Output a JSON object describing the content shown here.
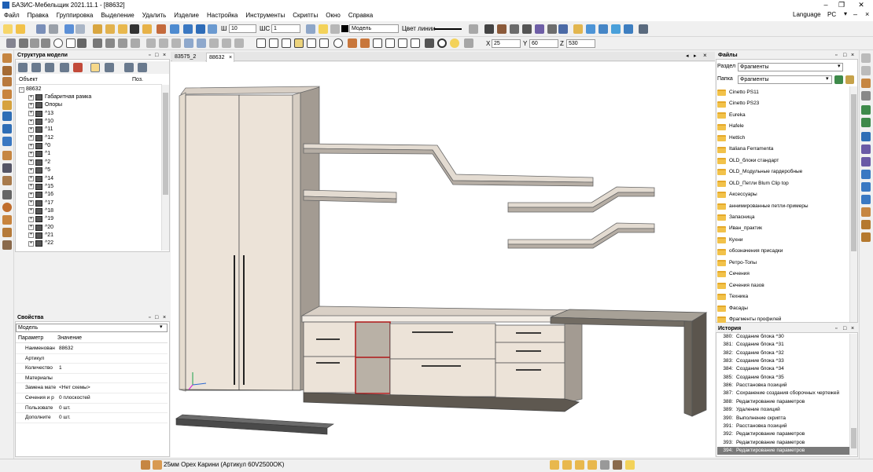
{
  "window": {
    "title": "БАЗИС-Мебельщик 2021.11.1 - [88632]"
  },
  "menu": [
    "Файл",
    "Правка",
    "Группировка",
    "Выделение",
    "Удалить",
    "Изделие",
    "Настройка",
    "Инструменты",
    "Скрипты",
    "Окно",
    "Справка"
  ],
  "menu_right": {
    "language": "Language",
    "locale": "PC"
  },
  "toolbar": {
    "line_width": "10",
    "sc_label": "ШС",
    "sc_value": "1",
    "w_label": "Ш",
    "layer": "Модель",
    "line_color_label": "Цвет линии",
    "x_label": "X",
    "x_value": "25",
    "y_label": "Y",
    "y_value": "60",
    "z_label": "Z",
    "z_value": "530"
  },
  "tabs": [
    {
      "label": "83575_2",
      "active": false
    },
    {
      "label": "88632",
      "active": true
    }
  ],
  "model_tree": {
    "title": "Структура модели",
    "col_object": "Объект",
    "col_pos": "Поз.",
    "root": "88632",
    "items": [
      "Габаритная рамка",
      "Опоры",
      "^13",
      "^10",
      "^11",
      "^12",
      "^0",
      "^1",
      "^2",
      "^5",
      "^14",
      "^15",
      "^16",
      "^17",
      "^18",
      "^19",
      "^20",
      "^21",
      "^22"
    ]
  },
  "properties": {
    "title": "Свойства",
    "selector": "Модель",
    "col_param": "Параметр",
    "col_value": "Значение",
    "rows": [
      {
        "param": "Наименован",
        "value": "88632"
      },
      {
        "param": "Артикул",
        "value": ""
      },
      {
        "param": "Количество",
        "value": "1"
      },
      {
        "param": "Материалы",
        "value": ""
      },
      {
        "param": "Замена мате",
        "value": "<Нет схемы>"
      },
      {
        "param": "Сечения и р",
        "value": "0 плоскостей"
      },
      {
        "param": "Пользовате",
        "value": "0 шт."
      },
      {
        "param": "Дополните",
        "value": "0 шт."
      }
    ]
  },
  "files": {
    "title": "Файлы",
    "section_label": "Раздел",
    "section_value": "Фрагменты",
    "folder_label": "Папка",
    "folder_value": "Фрагменты",
    "folders": [
      "Cinetto PS11",
      "Cinetto PS23",
      "Eureka",
      "Hafele",
      "Hettich",
      "Italiana Ferramenta",
      "OLD_блоки стандарт",
      "OLD_Модульные гардеробные",
      "OLD_Петли Blum Clip top",
      "Аксессуары",
      "аннимированные петли-примеры",
      "Запасница",
      "Иван_практик",
      "Кухни",
      "обозначения присадки",
      "Ретро-Топы",
      "Сечения",
      "Сечения пазов",
      "Техника",
      "Фасады",
      "Фрагменты профилей"
    ]
  },
  "history": {
    "title": "История",
    "items": [
      {
        "n": "380:",
        "text": "Создание блока ^30",
        "selected": false
      },
      {
        "n": "381:",
        "text": "Создание блока ^31",
        "selected": false
      },
      {
        "n": "382:",
        "text": "Создание блока ^32",
        "selected": false
      },
      {
        "n": "383:",
        "text": "Создание блока ^33",
        "selected": false
      },
      {
        "n": "384:",
        "text": "Создание блока ^34",
        "selected": false
      },
      {
        "n": "385:",
        "text": "Создание блока ^35",
        "selected": false
      },
      {
        "n": "386:",
        "text": "Расстановка позиций",
        "selected": false
      },
      {
        "n": "387:",
        "text": "Сохранение создания сборочных чертежей",
        "selected": false
      },
      {
        "n": "388:",
        "text": "Редактирование параметров",
        "selected": false
      },
      {
        "n": "389:",
        "text": "Удаление позиций",
        "selected": false
      },
      {
        "n": "390:",
        "text": "Выполнение скрипта",
        "selected": false
      },
      {
        "n": "391:",
        "text": "Расстановка позиций",
        "selected": false
      },
      {
        "n": "392:",
        "text": "Редактирование параметров",
        "selected": false
      },
      {
        "n": "393:",
        "text": "Редактирование параметров",
        "selected": false
      },
      {
        "n": "394:",
        "text": "Редактирование параметров",
        "selected": true
      }
    ]
  },
  "status": {
    "material": "25мм Орех Карини (Артикул 60V2500OK)"
  },
  "colors": {
    "cabinet": "#ece3d8",
    "cabinet_dark": "#a39b92",
    "highlight": "#b01818",
    "selection": "#7a7a7a"
  }
}
